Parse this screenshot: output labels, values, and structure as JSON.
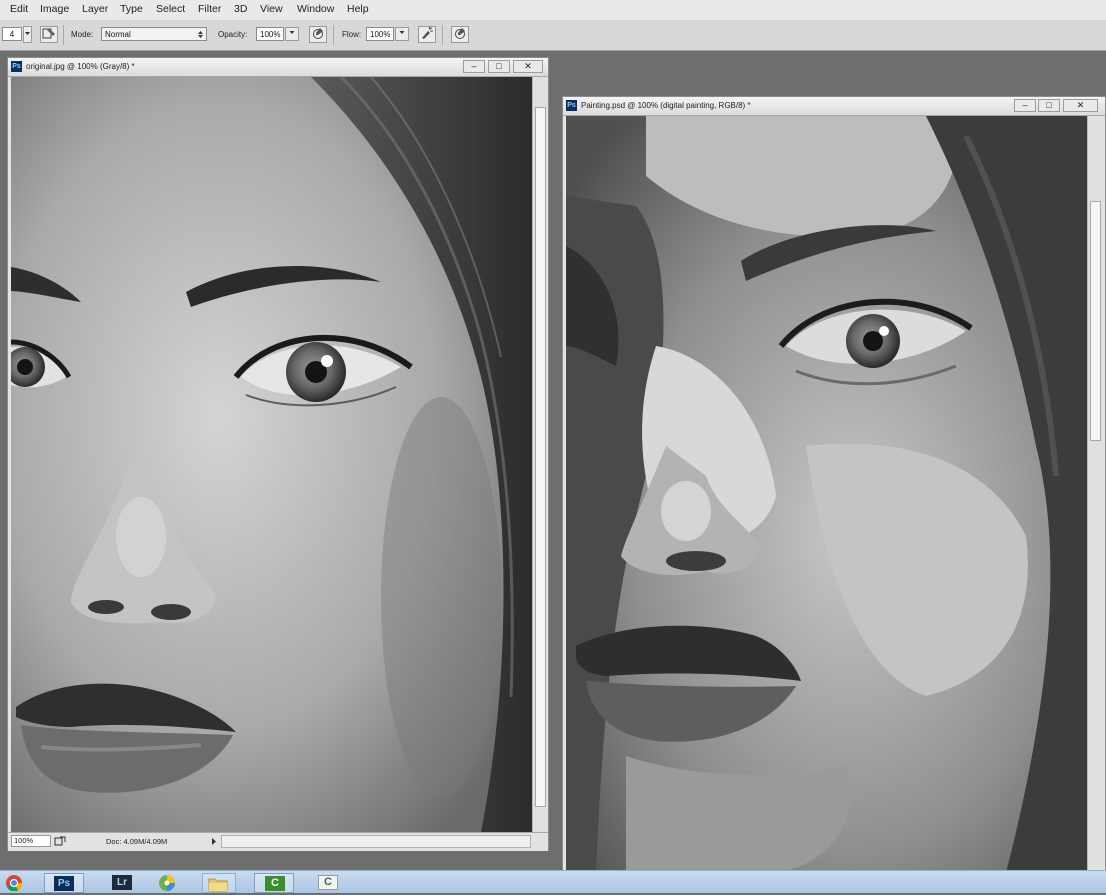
{
  "menu": [
    "Edit",
    "Image",
    "Layer",
    "Type",
    "Select",
    "Filter",
    "3D",
    "View",
    "Window",
    "Help"
  ],
  "options": {
    "brush_size": "4",
    "mode_label": "Mode:",
    "mode_value": "Normal",
    "opacity_label": "Opacity:",
    "opacity_value": "100%",
    "flow_label": "Flow:",
    "flow_value": "100%"
  },
  "windows": {
    "original": {
      "title": "original.jpg @ 100% (Gray/8) *",
      "zoom": "100%",
      "doc_info": "Doc: 4.09M/4.09M"
    },
    "painting": {
      "title": "Painting.psd @ 100% (digital painting, RGB/8) *"
    }
  },
  "window_controls": {
    "minimize": "–",
    "restore": "□",
    "close": "✕"
  },
  "taskbar": {
    "items": [
      "chrome",
      "photoshop",
      "lightroom",
      "picasa",
      "file-explorer",
      "camtasia",
      "camtasia-2"
    ],
    "labels": {
      "photoshop": "Ps",
      "lightroom": "Lr",
      "camtasia": "C",
      "camtasia2": "C"
    }
  }
}
